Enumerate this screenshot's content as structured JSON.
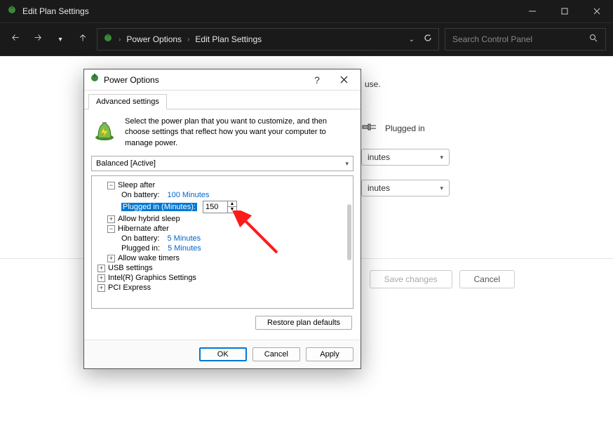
{
  "window": {
    "title": "Edit Plan Settings"
  },
  "breadcrumb": {
    "item1": "Power Options",
    "item2": "Edit Plan Settings"
  },
  "search": {
    "placeholder": "Search Control Panel"
  },
  "background": {
    "snippet1": "use.",
    "plugged_in": "Plugged in",
    "save": "Save changes",
    "cancel": "Cancel",
    "sel1_tail": "inutes",
    "sel2_tail": "inutes"
  },
  "dialog": {
    "title": "Power Options",
    "tab": "Advanced settings",
    "intro": "Select the power plan that you want to customize, and then choose settings that reflect how you want your computer to manage power.",
    "plan": "Balanced [Active]",
    "restore": "Restore plan defaults",
    "ok": "OK",
    "cancel": "Cancel",
    "apply": "Apply"
  },
  "tree": {
    "sleep_after": "Sleep after",
    "on_battery_label": "On battery:",
    "on_battery_value": "100 Minutes",
    "plugged_label": "Plugged in (Minutes):",
    "plugged_value": "150",
    "allow_hybrid": "Allow hybrid sleep",
    "hibernate_after": "Hibernate after",
    "hib_batt_label": "On battery:",
    "hib_batt_value": "5 Minutes",
    "hib_plug_label": "Plugged in:",
    "hib_plug_value": "5 Minutes",
    "allow_wake": "Allow wake timers",
    "usb": "USB settings",
    "intel_gfx": "Intel(R) Graphics Settings",
    "pci": "PCI Express"
  }
}
